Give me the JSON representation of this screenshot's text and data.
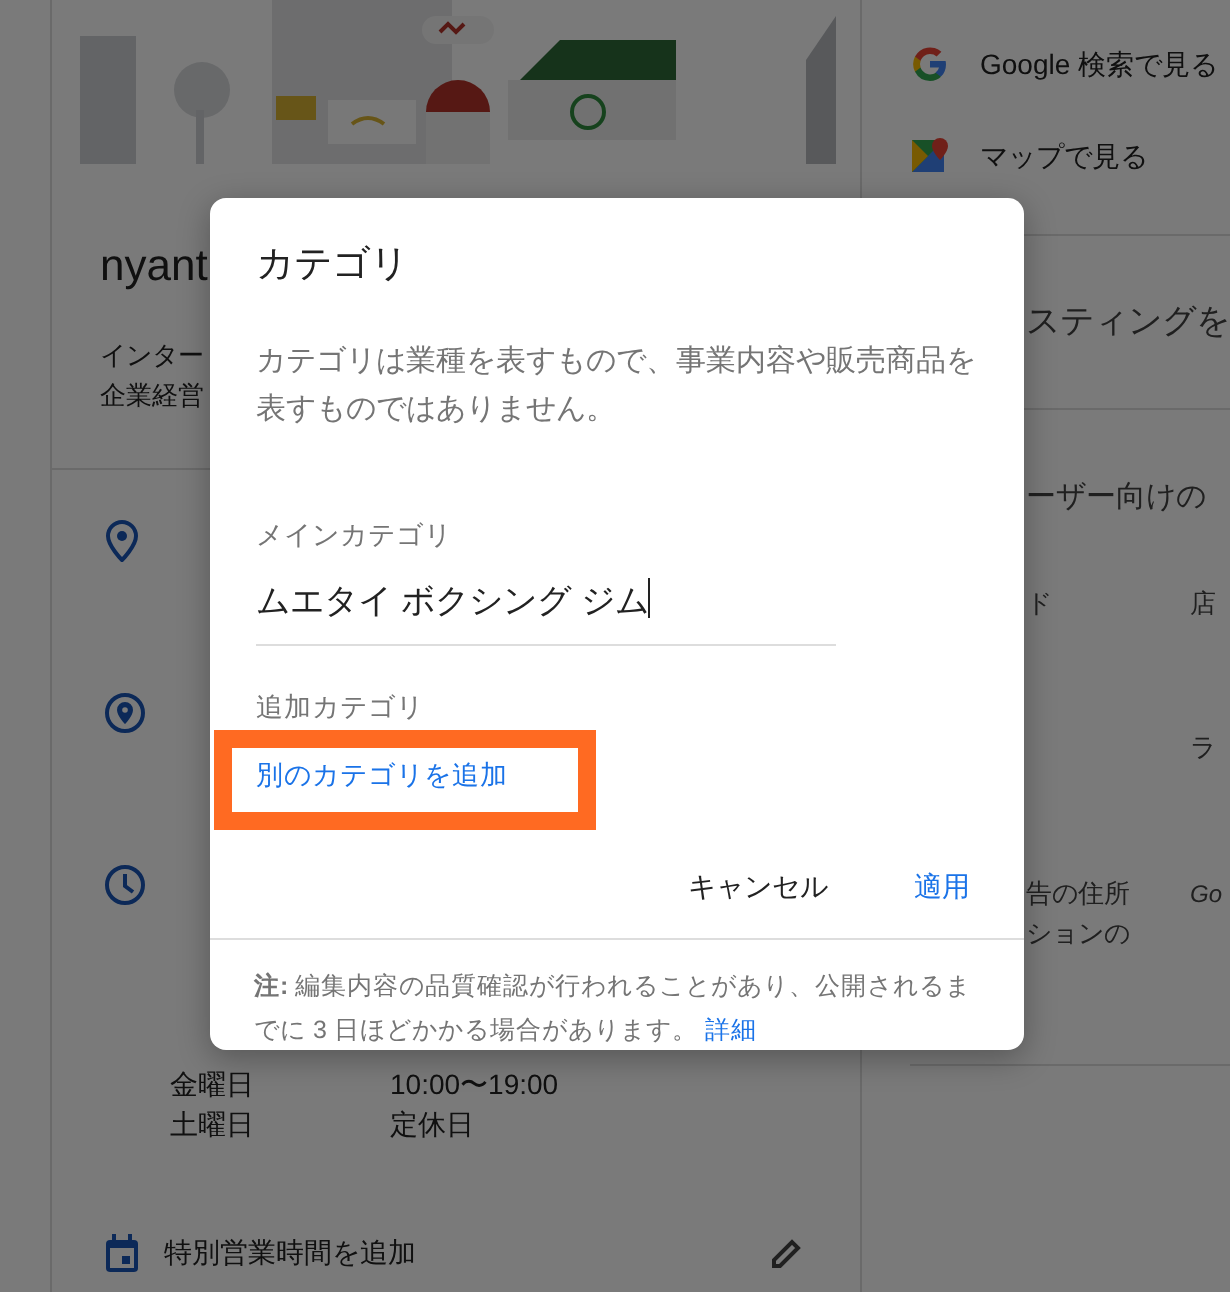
{
  "business": {
    "name": "nyant",
    "category_lines": [
      "インター",
      "企業経営"
    ]
  },
  "hours": [
    {
      "day": "金曜日",
      "time": "10:00〜19:00"
    },
    {
      "day": "土曜日",
      "time": "定休日"
    }
  ],
  "special_hours": {
    "label": "特別営業時間を追加"
  },
  "view_links": [
    {
      "kind": "search",
      "label": "Google 検索で見る"
    },
    {
      "kind": "maps",
      "label": "マップで見る"
    }
  ],
  "right_fragments": {
    "listing": "スティングを",
    "audience": "ーザー向けの",
    "row_1": {
      "left": "ド",
      "right": "店"
    },
    "row_2": {
      "right": "ラ"
    },
    "row_3": {
      "left_lines": [
        "告の住所",
        "ションの"
      ],
      "right": "Go"
    }
  },
  "dialog": {
    "title": "カテゴリ",
    "description": "カテゴリは業種を表すもので、事業内容や販売商品を表すものではありません。",
    "main_category": {
      "label": "メインカテゴリ",
      "value": "ムエタイ ボクシング ジム"
    },
    "additional_category": {
      "label": "追加カテゴリ",
      "add_link": "別のカテゴリを追加",
      "highlighted": true
    },
    "buttons": [
      {
        "kind": "secondary",
        "label": "キャンセル"
      },
      {
        "kind": "primary",
        "label": "適用"
      }
    ],
    "note": "**注:** 編集内容の品質確認が行われることがあり、公開されるまでに 3 日ほどかかる場合があります。",
    "note_link": "詳細"
  }
}
